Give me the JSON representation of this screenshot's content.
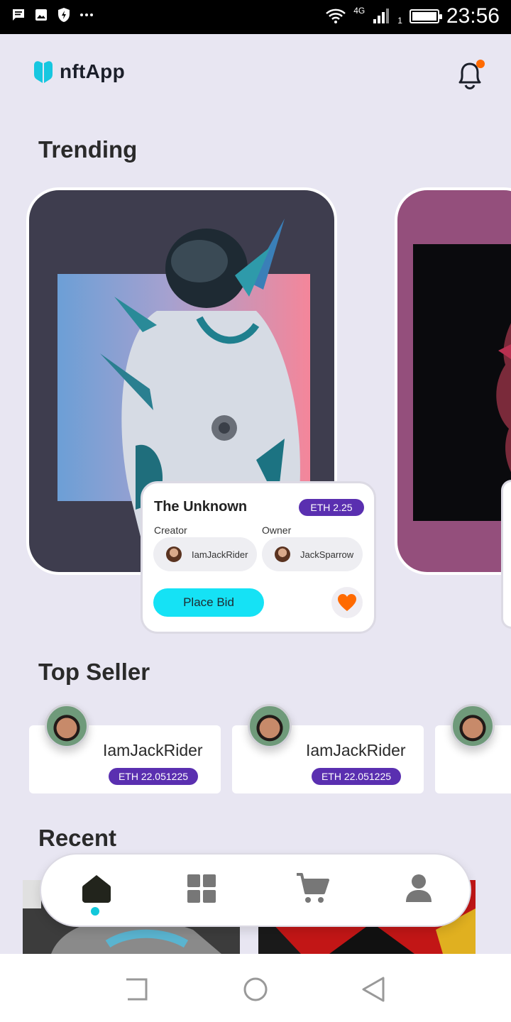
{
  "status_bar": {
    "network": "4G",
    "sim": "1",
    "time": "23:56",
    "icons": [
      "message-icon",
      "image-icon",
      "shield-icon",
      "more-icon",
      "wifi-icon",
      "signal-icon",
      "battery-icon"
    ]
  },
  "header": {
    "app_name": "nftApp",
    "brand_color": "#17c7e0",
    "notification_dot_color": "#ff6a00"
  },
  "sections": {
    "trending": "Trending",
    "top_seller": "Top Seller",
    "recent": "Recent"
  },
  "trending": {
    "card": {
      "title": "The Unknown",
      "price": "ETH 2.25",
      "creator_label": "Creator",
      "creator_name": "IamJackRider",
      "owner_label": "Owner",
      "owner_name": "JackSparrow",
      "button_label": "Place Bid",
      "button_color": "#15e2f5",
      "like_color": "#ff6a00"
    }
  },
  "top_sellers": [
    {
      "name": "IamJackRider",
      "value": "ETH 22.051225"
    },
    {
      "name": "IamJackRider",
      "value": "ETH 22.051225"
    }
  ],
  "tabs": [
    {
      "icon": "home-icon",
      "active": true
    },
    {
      "icon": "grid-icon",
      "active": false
    },
    {
      "icon": "cart-icon",
      "active": false
    },
    {
      "icon": "profile-icon",
      "active": false
    }
  ],
  "accent_color": "#5a2fb0"
}
